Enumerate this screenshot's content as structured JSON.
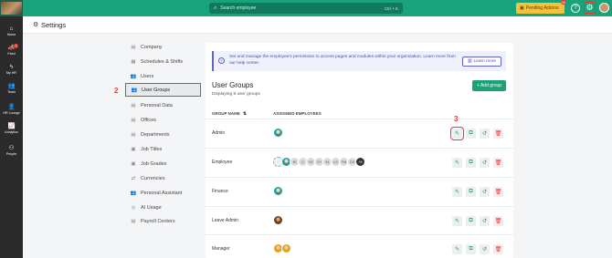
{
  "topbar": {
    "search_placeholder": "Search employee",
    "search_shortcut": "Ctrl + K",
    "pending_label": "Pending Actions",
    "pending_count": "99",
    "help_icon": "?"
  },
  "sidebar": {
    "items": [
      {
        "label": "Home",
        "icon": "⌂"
      },
      {
        "label": "Feed",
        "icon": "📣",
        "badge": "1"
      },
      {
        "label": "My HR",
        "icon": "ϟ"
      },
      {
        "label": "Team",
        "icon": "👥"
      },
      {
        "label": "HR Lounge",
        "icon": "👤"
      },
      {
        "label": "Analytics",
        "icon": "📈"
      },
      {
        "label": "People",
        "icon": "⚇"
      }
    ]
  },
  "header": {
    "title": "Settings"
  },
  "menu": {
    "items": [
      {
        "label": "Company",
        "icon": "▤"
      },
      {
        "label": "Schedules & Shifts",
        "icon": "▦"
      },
      {
        "label": "Users",
        "icon": "👥"
      },
      {
        "label": "User Groups",
        "icon": "👥"
      },
      {
        "label": "Personal Data",
        "icon": "▤"
      },
      {
        "label": "Offices",
        "icon": "▤"
      },
      {
        "label": "Departments",
        "icon": "▤"
      },
      {
        "label": "Job Titles",
        "icon": "▣"
      },
      {
        "label": "Job Grades",
        "icon": "▣"
      },
      {
        "label": "Currencies",
        "icon": "⇄"
      },
      {
        "label": "Personal Assistant",
        "icon": "👥"
      },
      {
        "label": "AI Usage",
        "icon": "◎"
      },
      {
        "label": "Payroll Centers",
        "icon": "▤"
      }
    ]
  },
  "info": {
    "text": "Set and manage the employee's permission to access pages and modules within your organization. Learn more from our help center.",
    "learn_more": "Learn more"
  },
  "user_groups": {
    "title": "User Groups",
    "subtitle": "Displaying 8 user groups",
    "add_button": "+ Add group",
    "col_name": "GROUP NAME",
    "col_employees": "ASSIGNED EMPLOYEES",
    "rows": [
      {
        "name": "Admin"
      },
      {
        "name": "Employee",
        "initials": [
          "JK",
          "C",
          "SY",
          "CY",
          "SL",
          "LS",
          "FM",
          "CN"
        ],
        "more": "+5"
      },
      {
        "name": "Finance"
      },
      {
        "name": "Leave Admin"
      },
      {
        "name": "Manager"
      }
    ]
  },
  "annotations": {
    "one": "1",
    "two": "2",
    "three": "3"
  }
}
